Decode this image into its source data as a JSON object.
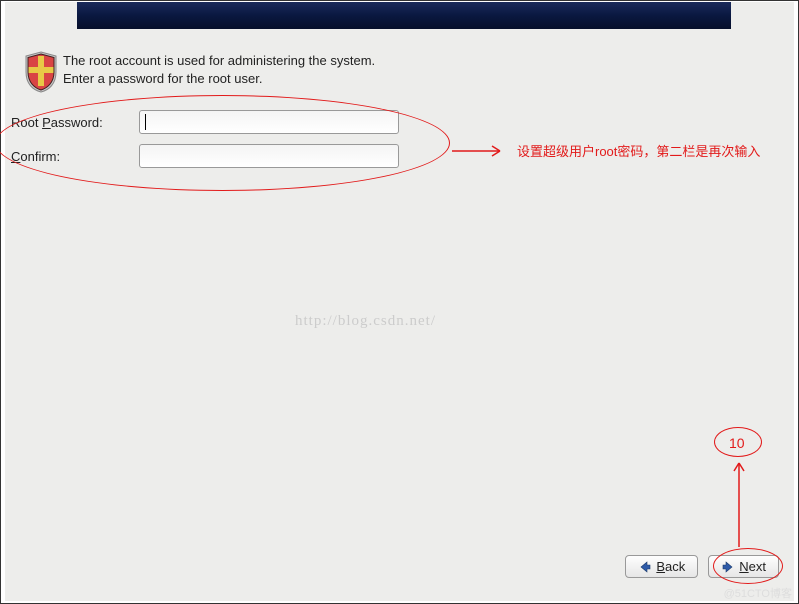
{
  "instruction": "The root account is used for administering the system.  Enter a password for the root user.",
  "form": {
    "password_label_pre": "Root ",
    "password_label_ul": "P",
    "password_label_post": "assword:",
    "confirm_label_ul": "C",
    "confirm_label_post": "onfirm:",
    "password_value": "",
    "confirm_value": ""
  },
  "annotations": {
    "chinese_text": "设置超级用户root密码，第二栏是再次输入",
    "step_number": "10"
  },
  "watermark": "http://blog.csdn.net/",
  "bottom_watermark": "@51CTO博客",
  "buttons": {
    "back_ul": "B",
    "back_post": "ack",
    "next_ul": "N",
    "next_post": "ext"
  }
}
